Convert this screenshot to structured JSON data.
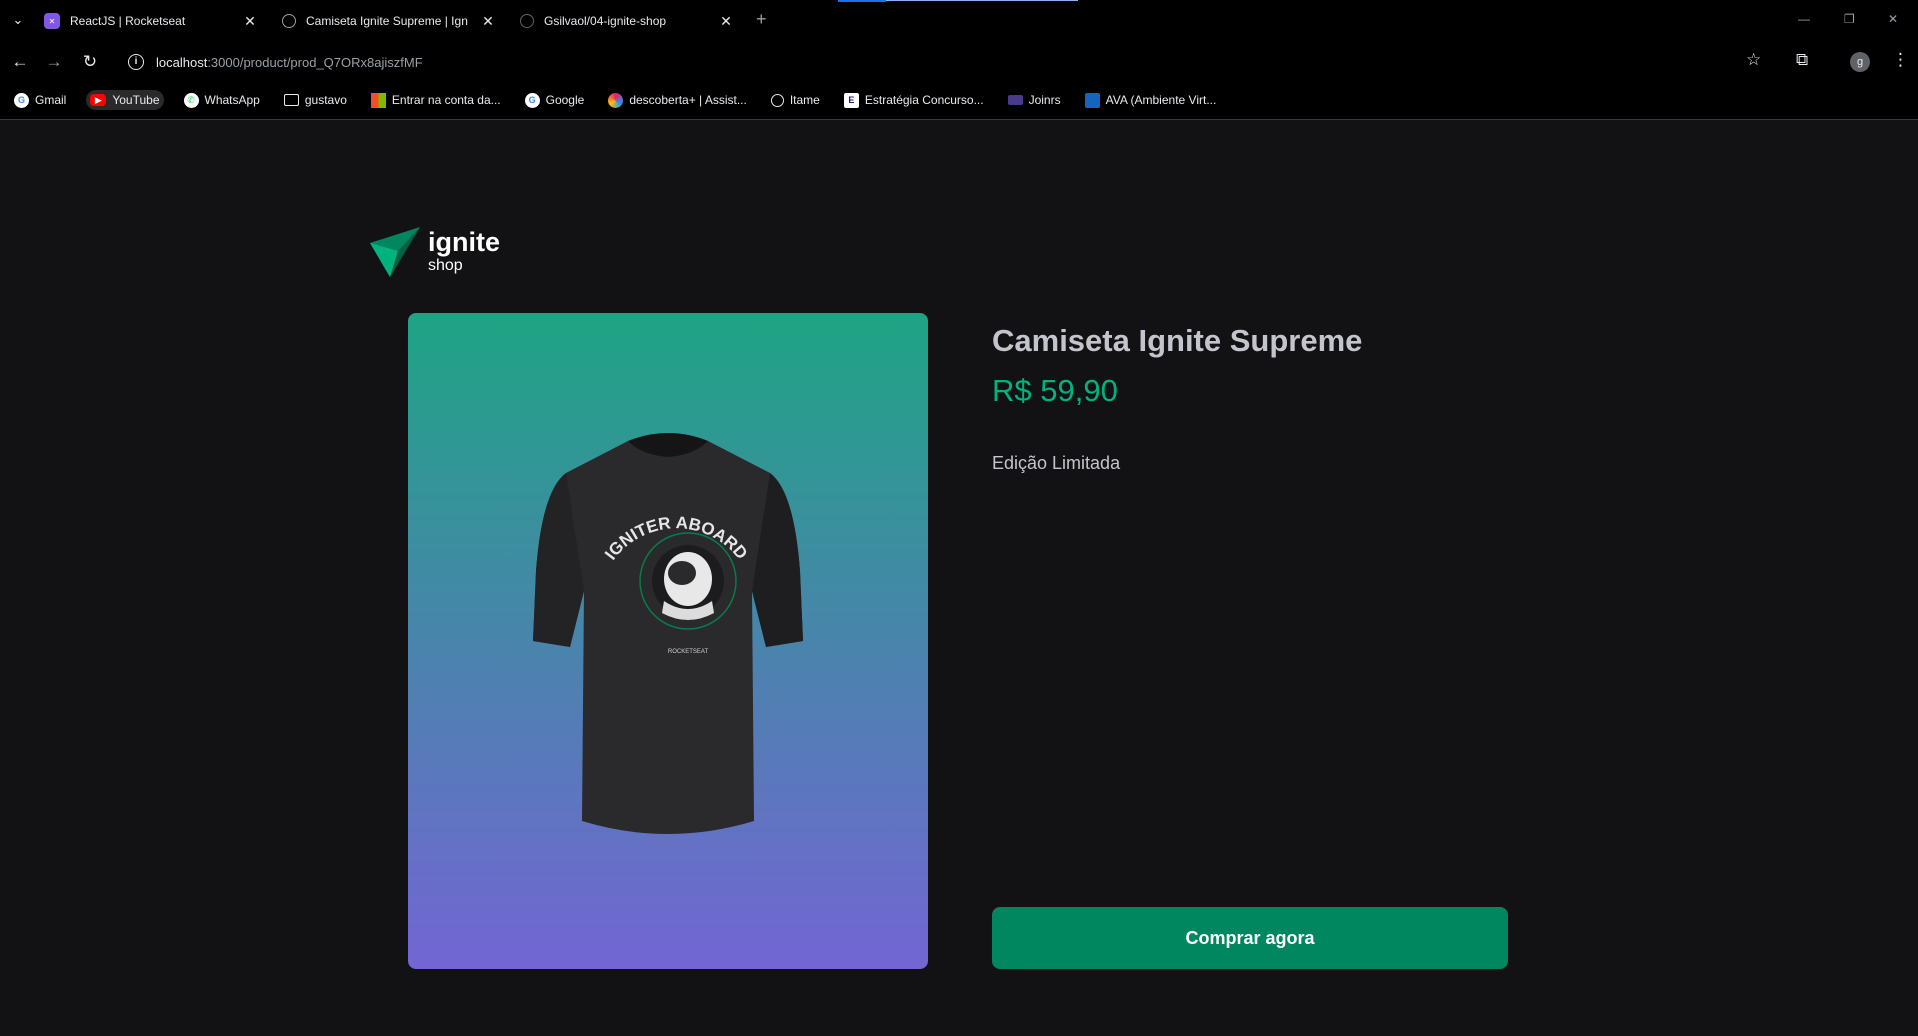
{
  "browser": {
    "tabs": [
      {
        "title": "ReactJS | Rocketseat",
        "favicon": "rocketseat-icon",
        "active": false
      },
      {
        "title": "Camiseta Ignite Supreme | Ignit",
        "favicon": "globe-icon",
        "active": true
      },
      {
        "title": "Gsilvaol/04-ignite-shop",
        "favicon": "github-icon",
        "active": false
      }
    ],
    "url_host": "localhost",
    "url_path": ":3000/product/prod_Q7ORx8ajiszfMF",
    "profile_initial": "g",
    "bookmarks": [
      {
        "label": "Gmail",
        "icon": "google-icon"
      },
      {
        "label": "YouTube",
        "icon": "youtube-icon"
      },
      {
        "label": "WhatsApp",
        "icon": "whatsapp-icon"
      },
      {
        "label": "gustavo",
        "icon": "folder-icon"
      },
      {
        "label": "Entrar na conta da...",
        "icon": "microsoft-icon"
      },
      {
        "label": "Google",
        "icon": "google-icon"
      },
      {
        "label": "descoberta+ | Assist...",
        "icon": "descoberta-icon"
      },
      {
        "label": "Itame",
        "icon": "globe-icon"
      },
      {
        "label": "Estratégia Concurso...",
        "icon": "estrategia-icon"
      },
      {
        "label": "Joinrs",
        "icon": "joinrs-icon"
      },
      {
        "label": "AVA (Ambiente Virt...",
        "icon": "ava-icon"
      }
    ]
  },
  "logo": {
    "word": "ignite",
    "sub": "shop"
  },
  "product": {
    "name": "Camiseta Ignite Supreme",
    "price": "R$ 59,90",
    "description": "Edição Limitada",
    "buy_label": "Comprar agora",
    "shirt_print_text": "IGNITER ABOARD",
    "shirt_brand": "ROCKETSEAT"
  },
  "colors": {
    "price": "#00b37e",
    "button": "#00875f",
    "gradient_top": "#1ea483",
    "gradient_bottom": "#7465d4",
    "background": "#121214"
  }
}
